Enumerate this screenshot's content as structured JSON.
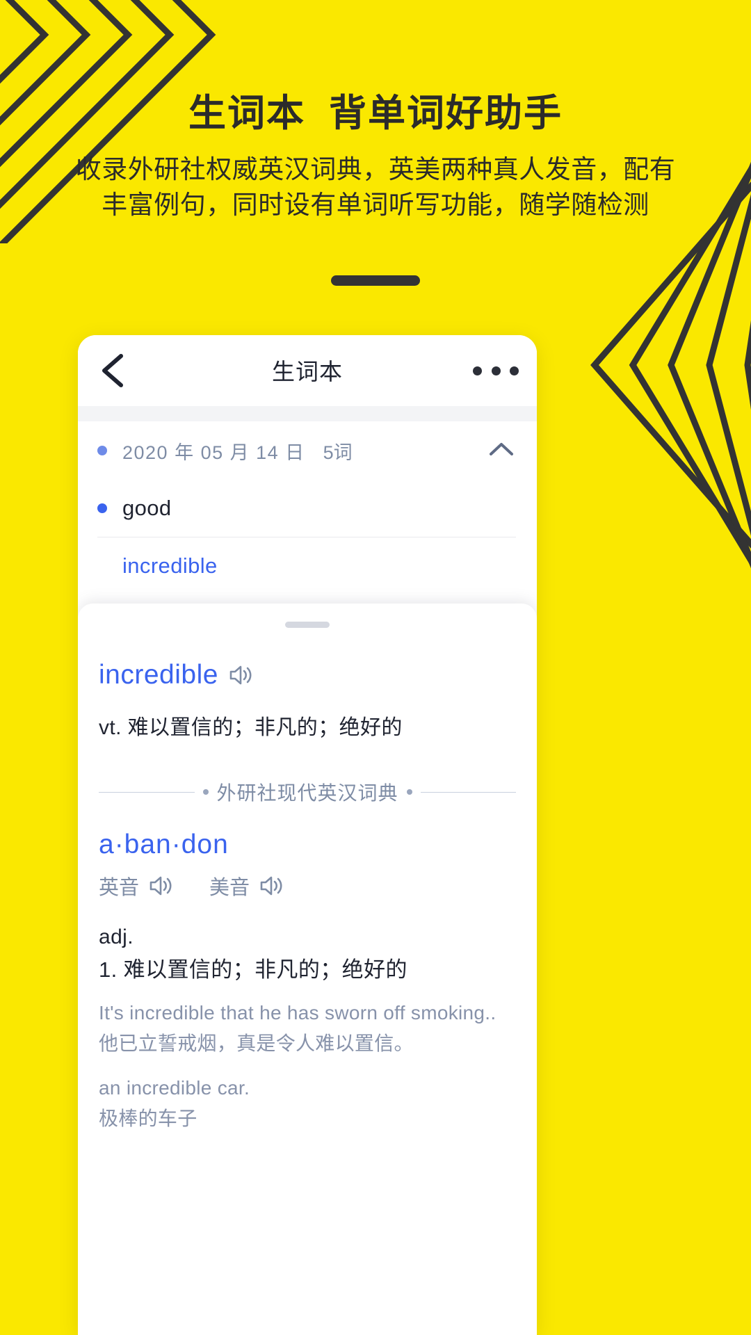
{
  "theme": {
    "background": "#FAE800",
    "ink": "#2B2B2B",
    "accent_blue": "#3A63EE",
    "muted_blue": "#7E8CA5",
    "card_bg": "#FFFFFF"
  },
  "hero": {
    "title": "生词本  背单词好助手",
    "subtitle": "收录外研社权威英汉词典，英美两种真人发音，配有丰富例句，同时设有单词听写功能，随学随检测"
  },
  "app": {
    "navbar": {
      "back_icon": "chevron-left-icon",
      "title": "生词本",
      "more_icon": "more-horizontal-icon"
    },
    "group": {
      "bullet_icon": "dot-icon",
      "date": "2020 年 05 月 14 日",
      "count": "5词",
      "collapse_icon": "chevron-up-icon"
    },
    "words": [
      {
        "label": "good",
        "style": "dark",
        "bullet": true
      },
      {
        "label": "incredible",
        "style": "blue",
        "bullet": false
      }
    ]
  },
  "sheet": {
    "handle_icon": "drag-handle-icon",
    "word": "incredible",
    "word_speaker_icon": "speaker-icon",
    "brief": "vt. 难以置信的；非凡的；绝好的",
    "dictionary_name": "外研社现代英汉词典",
    "headword": "a·ban·don",
    "pronunciations": [
      {
        "label": "英音",
        "icon": "speaker-icon"
      },
      {
        "label": "美音",
        "icon": "speaker-icon"
      }
    ],
    "part_of_speech": "adj.",
    "senses": [
      {
        "text": "1. 难以置信的；非凡的；绝好的",
        "examples": [
          {
            "en": "It's incredible that he has sworn off smoking..",
            "cn": "他已立誓戒烟，真是令人难以置信。"
          },
          {
            "en": "an incredible car.",
            "cn": "极棒的车子"
          }
        ]
      }
    ]
  }
}
